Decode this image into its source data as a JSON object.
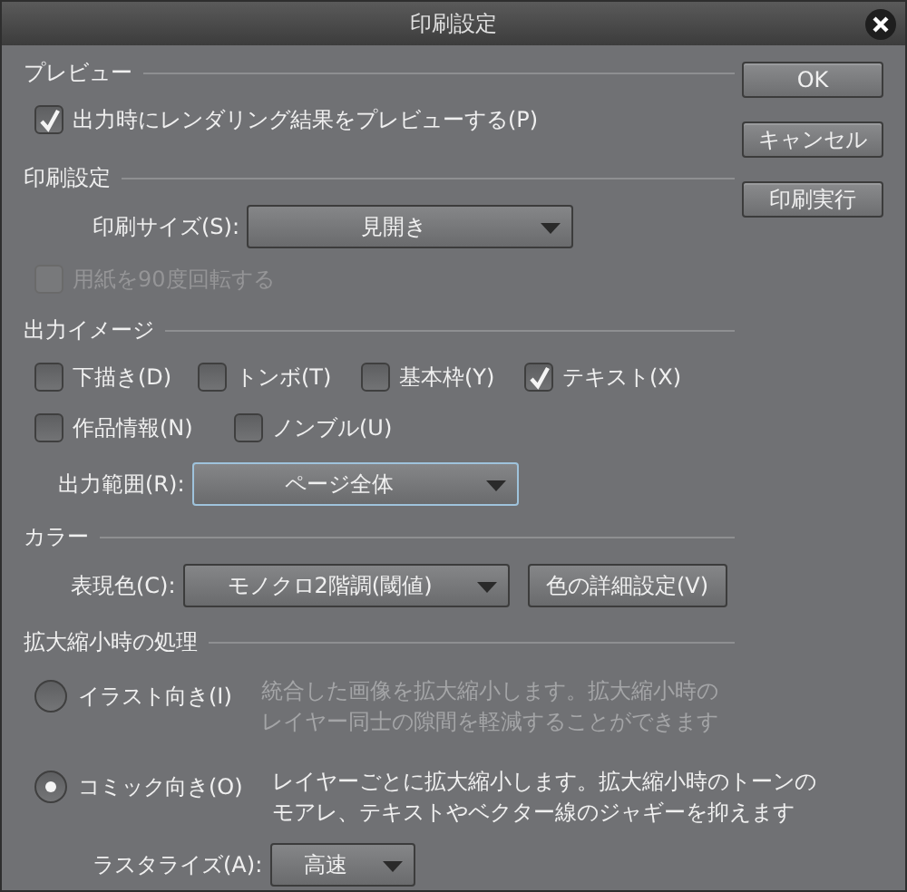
{
  "window": {
    "title": "印刷設定"
  },
  "buttons": [
    "OK",
    "キャンセル",
    "印刷実行"
  ],
  "sections": [
    {
      "title": "プレビュー",
      "rows": [
        [
          {
            "kind": "checkbox",
            "label": "出力時にレンダリング結果をプレビューする(P)",
            "checked": true,
            "disabled": false
          }
        ]
      ]
    },
    {
      "title": "印刷設定",
      "rows": [
        [
          {
            "kind": "select",
            "label": "印刷サイズ(S):",
            "value": "見開き",
            "focused": false
          }
        ],
        [
          {
            "kind": "checkbox",
            "label": "用紙を90度回転する",
            "checked": false,
            "disabled": true
          }
        ]
      ]
    },
    {
      "title": "出力イメージ",
      "rows": [
        [
          {
            "kind": "checkbox",
            "label": "下描き(D)",
            "checked": false,
            "disabled": false
          },
          {
            "kind": "checkbox",
            "label": "トンボ(T)",
            "checked": false,
            "disabled": false
          },
          {
            "kind": "checkbox",
            "label": "基本枠(Y)",
            "checked": false,
            "disabled": false
          },
          {
            "kind": "checkbox",
            "label": "テキスト(X)",
            "checked": true,
            "disabled": false
          }
        ],
        [
          {
            "kind": "checkbox",
            "label": "作品情報(N)",
            "checked": false,
            "disabled": false
          },
          {
            "kind": "checkbox",
            "label": "ノンブル(U)",
            "checked": false,
            "disabled": false
          }
        ],
        [
          {
            "kind": "select",
            "label": "出力範囲(R):",
            "value": "ページ全体",
            "focused": true
          }
        ]
      ]
    },
    {
      "title": "カラー",
      "rows": [
        [
          {
            "kind": "select",
            "label": "表現色(C):",
            "value": "モノクロ2階調(閾値)",
            "focused": false
          },
          {
            "kind": "button",
            "label": "色の詳細設定(V)"
          }
        ]
      ]
    },
    {
      "title": "拡大縮小時の処理",
      "rows": [
        [
          {
            "kind": "radio",
            "label": "イラスト向き(I)",
            "selected": false,
            "description": [
              "統合した画像を拡大縮小します。拡大縮小時の",
              "レイヤー同士の隙間を軽減することができます"
            ]
          }
        ],
        [
          {
            "kind": "radio",
            "label": "コミック向き(O)",
            "selected": true,
            "description": [
              "レイヤーごとに拡大縮小します。拡大縮小時のトーンの",
              "モアレ、テキストやベクター線のジャギーを抑えます"
            ]
          }
        ],
        [
          {
            "kind": "select",
            "label": "ラスタライズ(A):",
            "value": "高速",
            "focused": false
          }
        ]
      ]
    }
  ]
}
